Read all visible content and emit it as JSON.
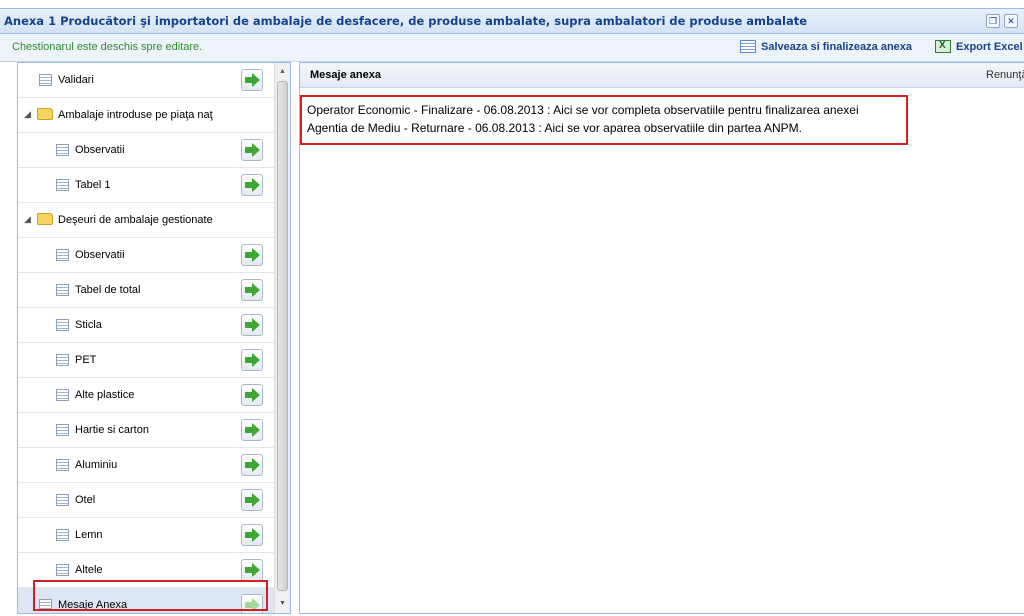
{
  "window": {
    "title": "Anexa 1 Producători şi importatori de ambalaje de desfacere, de produse ambalate, supra ambalatori de produse ambalate",
    "restore_glyph": "❐",
    "close_glyph": "✕"
  },
  "toolbar": {
    "status_text": "Chestionarul este deschis spre editare.",
    "save_label": "Salveaza si finalizeaza anexa",
    "export_label": "Export Excel"
  },
  "nav": {
    "items": [
      {
        "label": "Validari",
        "type": "item"
      },
      {
        "label": "Ambalaje introduse pe piaţa naţ",
        "type": "folder",
        "expanded": true
      },
      {
        "label": "Observatii",
        "type": "child"
      },
      {
        "label": "Tabel 1",
        "type": "child"
      },
      {
        "label": "Deşeuri de ambalaje gestionate",
        "type": "folder",
        "expanded": true
      },
      {
        "label": "Observatii",
        "type": "child"
      },
      {
        "label": "Tabel de total",
        "type": "child"
      },
      {
        "label": "Sticla",
        "type": "child"
      },
      {
        "label": "PET",
        "type": "child"
      },
      {
        "label": "Alte plastice",
        "type": "child"
      },
      {
        "label": "Hartie si carton",
        "type": "child"
      },
      {
        "label": "Aluminiu",
        "type": "child"
      },
      {
        "label": "Otel",
        "type": "child"
      },
      {
        "label": "Lemn",
        "type": "child"
      },
      {
        "label": "Altele",
        "type": "child"
      },
      {
        "label": "Mesaje Anexa",
        "type": "item",
        "selected": true
      }
    ],
    "expand_glyph": "◢"
  },
  "scroll": {
    "up_glyph": "▲",
    "down_glyph": "▼"
  },
  "messages_panel": {
    "title": "Mesaje anexa",
    "cancel_label": "Renunţă",
    "messages": [
      "Operator Economic - Finalizare - 06.08.2013 : Aici se vor completa observatiile pentru finalizarea anexei",
      "Agentia de Mediu - Returnare - 06.08.2013 : Aici se vor aparea observatiile din partea ANPM."
    ]
  },
  "colors": {
    "highlight": "#d62020",
    "title_text": "#15428b",
    "status_text": "#2e8b2e",
    "border": "#99bbe8"
  }
}
